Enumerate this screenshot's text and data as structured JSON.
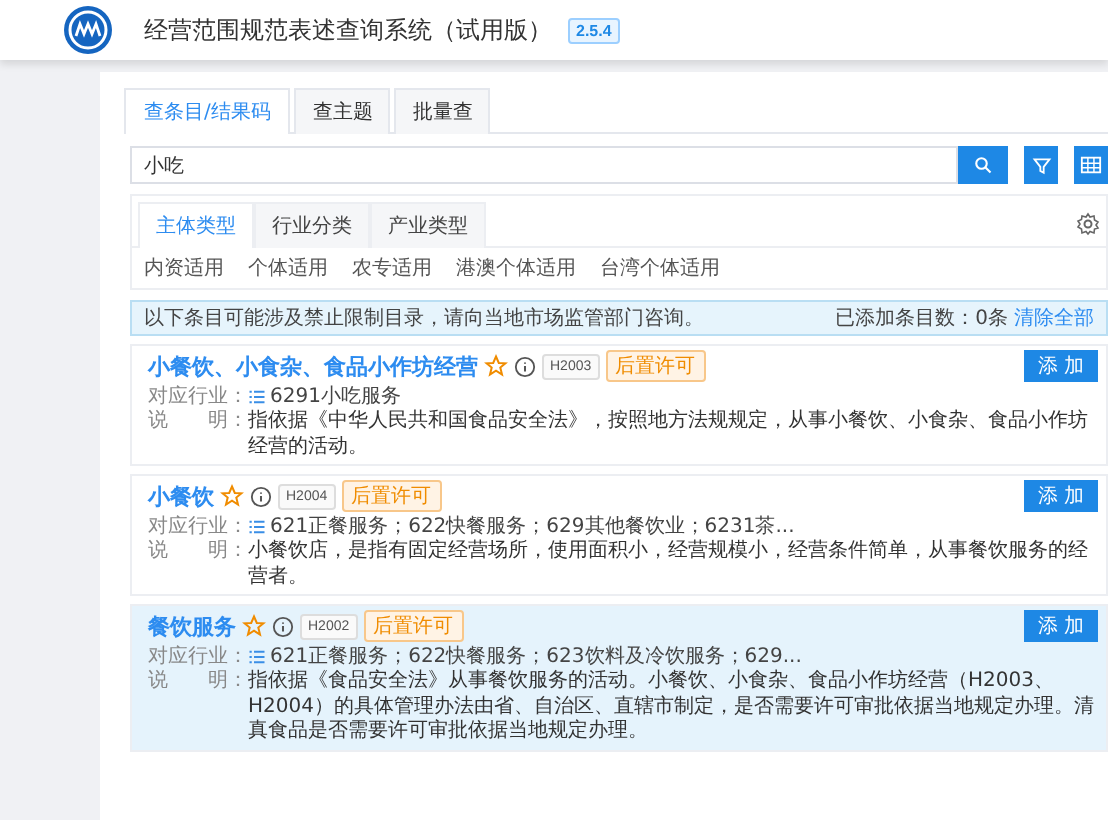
{
  "header": {
    "title": "经营范围规范表述查询系统（试用版）",
    "version": "2.5.4"
  },
  "tabs": [
    {
      "label": "查条目/结果码",
      "selected": true
    },
    {
      "label": "查主题",
      "selected": false
    },
    {
      "label": "批量查",
      "selected": false
    }
  ],
  "search": {
    "value": "小吃"
  },
  "filter_tabs": [
    {
      "label": "主体类型",
      "selected": true
    },
    {
      "label": "行业分类",
      "selected": false
    },
    {
      "label": "产业类型",
      "selected": false
    }
  ],
  "filter_options": [
    "内资适用",
    "个体适用",
    "农专适用",
    "港澳个体适用",
    "台湾个体适用"
  ],
  "notice": {
    "text": "以下条目可能涉及禁止限制目录，请向当地市场监管部门咨询。",
    "count": "已添加条目数：0条",
    "clear_link": "清除全部"
  },
  "results": [
    {
      "title": "小餐饮、小食杂、食品小作坊经营",
      "code": "H2003",
      "permit": "后置许可",
      "industry_label": "对应行业：",
      "industry": "6291小吃服务",
      "desc_label": "说　　明：",
      "desc": "指依据《中华人民共和国食品安全法》，按照地方法规规定，从事小餐饮、小食杂、食品小作坊经营的活动。",
      "add": "添 加",
      "highlighted": false
    },
    {
      "title": "小餐饮",
      "code": "H2004",
      "permit": "后置许可",
      "industry_label": "对应行业：",
      "industry": "621正餐服务；622快餐服务；629其他餐饮业；6231茶...",
      "desc_label": "说　　明：",
      "desc": "小餐饮店，是指有固定经营场所，使用面积小，经营规模小，经营条件简单，从事餐饮服务的经营者。",
      "add": "添 加",
      "highlighted": false
    },
    {
      "title": "餐饮服务",
      "code": "H2002",
      "permit": "后置许可",
      "industry_label": "对应行业：",
      "industry": "621正餐服务；622快餐服务；623饮料及冷饮服务；629...",
      "desc_label": "说　　明：",
      "desc": "指依据《食品安全法》从事餐饮服务的活动。小餐饮、小食杂、食品小作坊经营（H2003、H2004）的具体管理办法由省、自治区、直辖市制定，是否需要许可审批依据当地规定办理。清真食品是否需要许可审批依据当地规定办理。",
      "add": "添 加",
      "highlighted": true
    }
  ]
}
